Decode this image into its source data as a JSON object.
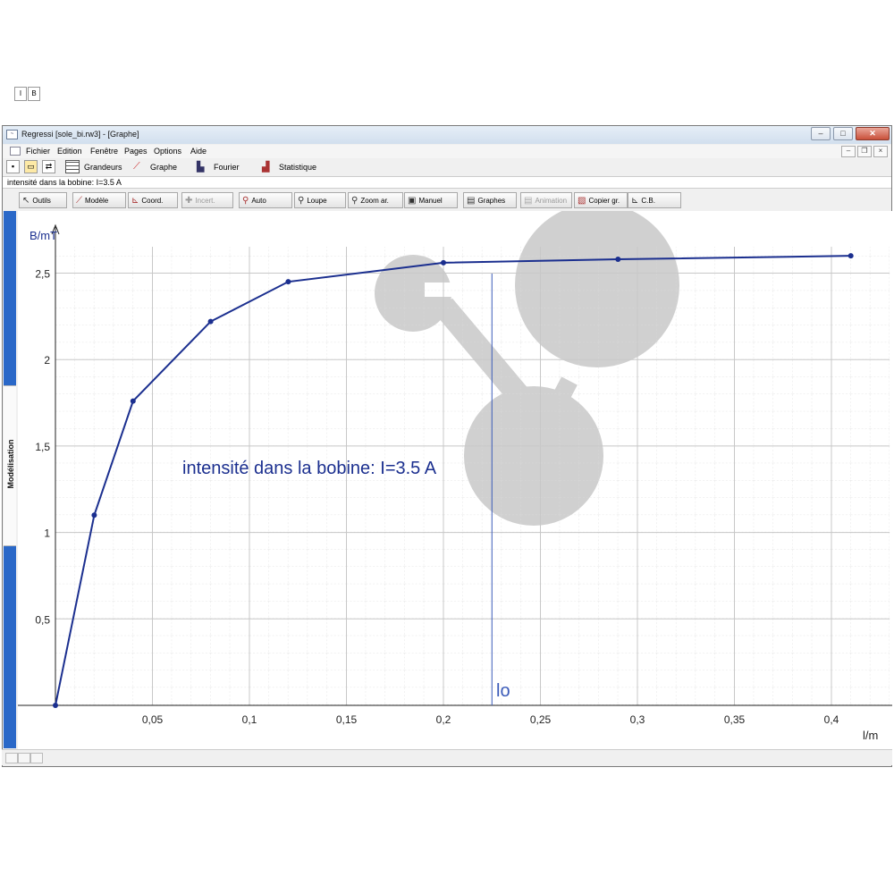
{
  "window": {
    "title": "Regressi [sole_bi.rw3] - [Graphe]"
  },
  "menu": [
    "Fichier",
    "Edition",
    "Fenêtre",
    "Pages",
    "Options",
    "Aide"
  ],
  "tabs": {
    "grandeurs": "Grandeurs",
    "graphe": "Graphe",
    "fourier": "Fourier",
    "statistique": "Statistique"
  },
  "info_bar": "intensité dans la bobine: I=3.5 A",
  "toolbar": [
    "Outils",
    "Modèle",
    "Coord.",
    "Incert.",
    "Auto",
    "Loupe",
    "Zoom ar.",
    "Manuel",
    "Graphes",
    "Animation",
    "Copier gr.",
    "C.B."
  ],
  "var_tabs": [
    "I",
    "B"
  ],
  "sidebar_label": "Modélisation",
  "annotation": "intensité dans la bobine: I=3.5 A",
  "marker_label": "lo",
  "colors": {
    "curve": "#1b2f8f",
    "accent": "#2a68c8",
    "marker": "#3a5ab8",
    "watermark": "#d0d0d0"
  },
  "chart_data": {
    "type": "line",
    "xlabel": "l/m",
    "ylabel": "B/mT",
    "x": [
      0,
      0.02,
      0.04,
      0.08,
      0.12,
      0.2,
      0.29,
      0.41
    ],
    "y": [
      0,
      1.1,
      1.76,
      2.22,
      2.45,
      2.56,
      2.58,
      2.6
    ],
    "xlim": [
      0,
      0.42
    ],
    "ylim": [
      0,
      2.6
    ],
    "xticks": [
      0.05,
      0.1,
      0.15,
      0.2,
      0.25,
      0.3,
      0.35,
      0.4
    ],
    "xtick_labels": [
      "0,05",
      "0,1",
      "0,15",
      "0,2",
      "0,25",
      "0,3",
      "0,35",
      "0,4"
    ],
    "yticks": [
      0.5,
      1,
      1.5,
      2,
      2.5
    ],
    "ytick_labels": [
      "0,5",
      "1",
      "1,5",
      "2",
      "2,5"
    ],
    "marker_x": 0.225,
    "grid": true
  }
}
